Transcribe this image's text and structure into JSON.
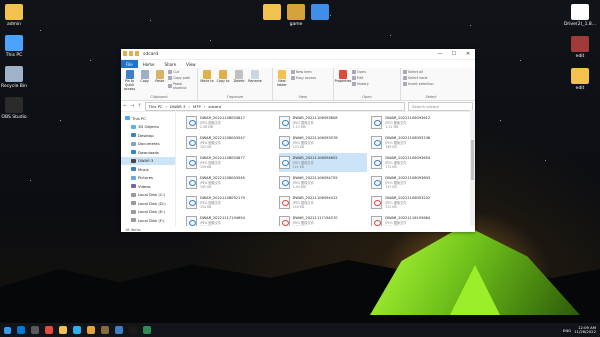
{
  "desktop": {
    "icons_left": [
      {
        "label": "admin",
        "color": "#f2c14e"
      },
      {
        "label": "This PC",
        "color": "#4aa3ff"
      },
      {
        "label": "Recycle Bin",
        "color": "#9fb3c8"
      },
      {
        "label": "OBS Studio",
        "color": "#2b2b2b"
      }
    ],
    "icons_top": [
      {
        "label": "",
        "color": "#f2c14e"
      },
      {
        "label": "game",
        "color": "#d6a23a"
      },
      {
        "label": "",
        "color": "#3f8fe8"
      }
    ],
    "icons_right": [
      {
        "label": "Drive(2)_1.8...",
        "color": "#ffffff"
      },
      {
        "label": "edit",
        "color": "#a33a3a"
      },
      {
        "label": "edit",
        "color": "#f2c14e"
      }
    ]
  },
  "window": {
    "title": "sdcard",
    "controls": [
      "—",
      "☐",
      "✕"
    ],
    "tabs": [
      "File",
      "Home",
      "Share",
      "View"
    ],
    "ribbon": {
      "clipboard": {
        "name": "Clipboard",
        "pin_label": "Pin to Quick access",
        "copy_label": "Copy",
        "paste_label": "Paste",
        "cut_label": "Cut",
        "copy_path_label": "Copy path",
        "paste_shortcut_label": "Paste shortcut"
      },
      "organize": {
        "name": "Organize",
        "move_label": "Move to",
        "copy_to_label": "Copy to",
        "delete_label": "Delete",
        "rename_label": "Rename"
      },
      "new": {
        "name": "New",
        "folder_label": "New folder",
        "item_label": "New item",
        "easy_access_label": "Easy access"
      },
      "open": {
        "name": "Open",
        "properties_label": "Properties",
        "open_label": "Open",
        "edit_label": "Edit",
        "history_label": "History"
      },
      "select": {
        "name": "Select",
        "all_label": "Select all",
        "none_label": "Select none",
        "invert_label": "Invert selection"
      }
    },
    "address": {
      "crumbs": [
        "This PC",
        "DWAR 3",
        "MTP",
        "sdcard"
      ],
      "search_placeholder": "Search sdcard"
    },
    "nav_items": [
      {
        "label": "This PC",
        "icon": "#4aa3ff",
        "sub": false,
        "selected": false
      },
      {
        "label": "3D Objects",
        "icon": "#5ab0e8",
        "sub": true,
        "selected": false
      },
      {
        "label": "Desktop",
        "icon": "#3f7fc4",
        "sub": true,
        "selected": false
      },
      {
        "label": "Documents",
        "icon": "#8aa0b8",
        "sub": true,
        "selected": false
      },
      {
        "label": "Downloads",
        "icon": "#2d83d6",
        "sub": true,
        "selected": false
      },
      {
        "label": "DWAR 3",
        "icon": "#444444",
        "sub": true,
        "selected": true
      },
      {
        "label": "Music",
        "icon": "#3f7fc4",
        "sub": true,
        "selected": false
      },
      {
        "label": "Pictures",
        "icon": "#6aa6df",
        "sub": true,
        "selected": false
      },
      {
        "label": "Videos",
        "icon": "#6c6c9c",
        "sub": true,
        "selected": false
      },
      {
        "label": "Local Disk (C:)",
        "icon": "#999999",
        "sub": true,
        "selected": false
      },
      {
        "label": "Local Disk (D:)",
        "icon": "#999999",
        "sub": true,
        "selected": false
      },
      {
        "label": "Local Disk (E:)",
        "icon": "#999999",
        "sub": true,
        "selected": false
      },
      {
        "label": "Local Disk (F:)",
        "icon": "#999999",
        "sub": true,
        "selected": false
      }
    ],
    "files": [
      {
        "name": "DWAR_20221106093617",
        "type": "JPEG 图像文件",
        "size": "2.48 MB",
        "img": false,
        "selected": false
      },
      {
        "name": "DWAR_20221106093608",
        "type": "JPEG 图像文件",
        "size": "1.13 MB",
        "img": false,
        "selected": false
      },
      {
        "name": "DWAR_20221106093612",
        "type": "JPEG 图像文件",
        "size": "1.51 MB",
        "img": false,
        "selected": false
      },
      {
        "name": "DWAR_20221106093547",
        "type": "JPEG 图像文件",
        "size": "103 KB",
        "img": false,
        "selected": false
      },
      {
        "name": "DWAR_20221106093578",
        "type": "JPEG 图像文件",
        "size": "132 KB",
        "img": false,
        "selected": false
      },
      {
        "name": "DWAR_20221106093746",
        "type": "JPEG 图像文件",
        "size": "165 KB",
        "img": false,
        "selected": false
      },
      {
        "name": "DWAR_20221106093677",
        "type": "JPEG 图像文件",
        "size": "159 KB",
        "img": false,
        "selected": false
      },
      {
        "name": "DWAR_20221106094652",
        "type": "JPEG 图像文件",
        "size": "121 KB",
        "img": false,
        "selected": true
      },
      {
        "name": "DWAR_20221106093654",
        "type": "JPEG 图像文件",
        "size": "172 KB",
        "img": false,
        "selected": false
      },
      {
        "name": "DWAR_20221106093545",
        "type": "JPEG 图像文件",
        "size": "195 KB",
        "img": false,
        "selected": false
      },
      {
        "name": "DWAR_20221106094755",
        "type": "JPEG 图像文件",
        "size": "1.04 MB",
        "img": false,
        "selected": false
      },
      {
        "name": "DWAR_20221106093603",
        "type": "JPEG 图像文件",
        "size": "157 KB",
        "img": false,
        "selected": false
      },
      {
        "name": "DWAR_20221106092179",
        "type": "JPEG 图像文件",
        "size": "154 KB",
        "img": false,
        "selected": false
      },
      {
        "name": "DWAR_20221106094412",
        "type": "JPEG 图像文件",
        "size": "140 KB",
        "img": true,
        "selected": false
      },
      {
        "name": "DWAR_20221106093232",
        "type": "JPEG 图像文件",
        "size": "312 KB",
        "img": true,
        "selected": false
      },
      {
        "name": "DWAR_20221117194654",
        "type": "JPEG 图像文件",
        "size": "184 KB",
        "img": false,
        "selected": false
      },
      {
        "name": "DWAR_20221117194570",
        "type": "JPEG 图像文件",
        "size": "2.84 MB",
        "img": true,
        "selected": false
      },
      {
        "name": "DWAR_20221116195664",
        "type": "JPEG 图像文件",
        "size": "1.04 MB",
        "img": true,
        "selected": false
      },
      {
        "name": "DWAR_20221206400730",
        "type": "JPEG 图像文件",
        "size": "1.10 MB",
        "img": false,
        "selected": false
      },
      {
        "name": "DWAR_20221201184550",
        "type": "JPEG 图像文件",
        "size": "1.06 MB",
        "img": true,
        "selected": false
      },
      {
        "name": "DWAR_20221116194644",
        "type": "JPEG 图像文件",
        "size": "563 KB",
        "img": true,
        "selected": false
      }
    ],
    "status": "18 items"
  },
  "taskbar": {
    "apps": [
      "#0078d4",
      "#5a5a5a",
      "#e84b3c",
      "#f2c14e",
      "#2bb0ed",
      "#e8a33a",
      "#8a6a3a",
      "#3f7fc4",
      "#1a1a1a",
      "#2e8b57"
    ],
    "tray_label": "ENG",
    "time": "12:09 AM",
    "date": "11/26/2022"
  }
}
